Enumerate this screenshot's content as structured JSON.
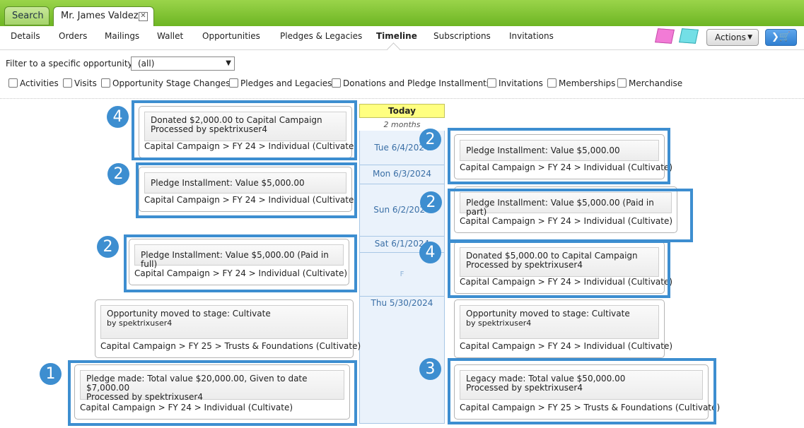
{
  "tabs": {
    "search": "Search",
    "client": "Mr. James Valdez"
  },
  "nav": {
    "items": [
      "Details",
      "Orders",
      "Mailings",
      "Wallet",
      "Opportunities",
      "Pledges & Legacies",
      "Timeline",
      "Subscriptions",
      "Invitations"
    ],
    "active": "Timeline",
    "actions_label": "Actions"
  },
  "filter": {
    "label": "Filter to a specific opportunity:",
    "selected": "(all)",
    "checkboxes": [
      "Activities",
      "Visits",
      "Opportunity Stage Changes",
      "Pledges and Legacies",
      "Donations and Pledge Installments",
      "Invitations",
      "Memberships",
      "Merchandise"
    ]
  },
  "timeline": {
    "today": "Today",
    "gap": "2 months",
    "dates": [
      "Tue 6/4/2024",
      "Mon 6/3/2024",
      "Sun 6/2/2024",
      "Sat 6/1/2024",
      "Thu 5/30/2024"
    ],
    "marker": "F"
  },
  "cards": [
    {
      "line1": "Donated $2,000.00 to Capital Campaign",
      "line2": "Processed by spektrixuser4",
      "path": "Capital Campaign > FY 24 > Individual (Cultivate)",
      "badge": "4"
    },
    {
      "line1": "Pledge Installment: Value $5,000.00",
      "path": "Capital Campaign > FY 24 > Individual (Cultivate)",
      "badge": "2"
    },
    {
      "line1": "Pledge Installment: Value $5,000.00 (Paid in full)",
      "path": "Capital Campaign > FY 24 > Individual (Cultivate)",
      "badge": "2"
    },
    {
      "line1": "Opportunity moved to stage: Cultivate",
      "line2": "by spektrixuser4",
      "path": "Capital Campaign > FY 25 > Trusts & Foundations (Cultivate)"
    },
    {
      "line1": "Pledge made: Total value $20,000.00, Given to date $7,000.00",
      "line2": "Processed by spektrixuser4",
      "path": "Capital Campaign > FY 24 > Individual (Cultivate)",
      "badge": "1"
    },
    {
      "line1": "Pledge Installment: Value $5,000.00",
      "path": "Capital Campaign > FY 24 > Individual (Cultivate)",
      "badge": "2"
    },
    {
      "line1": "Pledge Installment: Value $5,000.00 (Paid in part)",
      "path": "Capital Campaign > FY 24 > Individual (Cultivate)",
      "badge": "2"
    },
    {
      "line1": "Donated $5,000.00 to Capital Campaign",
      "line2": "Processed by spektrixuser4",
      "path": "Capital Campaign > FY 24 > Individual (Cultivate)",
      "badge": "4"
    },
    {
      "line1": "Opportunity moved to stage: Cultivate",
      "line2": "by spektrixuser4",
      "path": "Capital Campaign > FY 24 > Individual (Cultivate)"
    },
    {
      "line1": "Legacy made: Total value $50,000.00",
      "line2": "Processed by spektrixuser4",
      "path": "Capital Campaign > FY 25 > Trusts & Foundations (Cultivate)",
      "badge": "3"
    }
  ],
  "colors": {
    "accent_green": "#7cc233",
    "highlight_blue": "#3d8ed0",
    "today_yellow": "#ffff80"
  }
}
